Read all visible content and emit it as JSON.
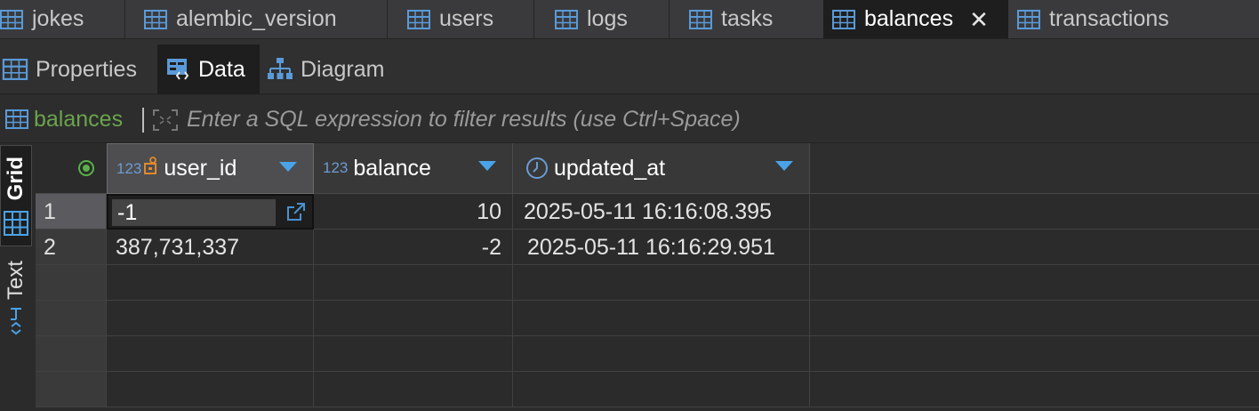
{
  "editor_tabs": [
    {
      "label": "jokes",
      "icon": "table-icon",
      "active": false
    },
    {
      "label": "alembic_version",
      "icon": "table-icon",
      "active": false
    },
    {
      "label": "users",
      "icon": "table-icon",
      "active": false
    },
    {
      "label": "logs",
      "icon": "table-icon",
      "active": false
    },
    {
      "label": "tasks",
      "icon": "table-icon",
      "active": false
    },
    {
      "label": "balances",
      "icon": "table-icon",
      "active": true
    },
    {
      "label": "transactions",
      "icon": "table-icon",
      "active": false
    }
  ],
  "sub_tabs": [
    {
      "label": "Properties",
      "icon": "table-icon",
      "active": false
    },
    {
      "label": "Data",
      "icon": "data-icon",
      "active": true
    },
    {
      "label": "Diagram",
      "icon": "diagram-icon",
      "active": false
    }
  ],
  "filter": {
    "entity": "balances",
    "placeholder": "Enter a SQL expression to filter results (use Ctrl+Space)"
  },
  "side_tabs": [
    {
      "label": "Grid",
      "icon": "grid-icon",
      "active": true
    },
    {
      "label": "Text",
      "icon": "text-icon",
      "active": false
    }
  ],
  "columns": [
    {
      "label": "user_id",
      "type_badge": "123",
      "key": true
    },
    {
      "label": "balance",
      "type_badge": "123",
      "key": false
    },
    {
      "label": "updated_at",
      "type_badge": "",
      "icon": "clock-icon",
      "key": false
    }
  ],
  "rows": [
    {
      "num": "1",
      "user_id": "-1",
      "balance": "10",
      "updated_at": "2025-05-11 16:16:08.395"
    },
    {
      "num": "2",
      "user_id": "387,731,337",
      "balance": "-2",
      "updated_at": "2025-05-11 16:16:29.951"
    }
  ],
  "colors": {
    "accent_blue": "#4aa3e8",
    "entity_green": "#6aa44c",
    "key_orange": "#e08a2c",
    "active_tab_bg": "#1e1e1e"
  }
}
